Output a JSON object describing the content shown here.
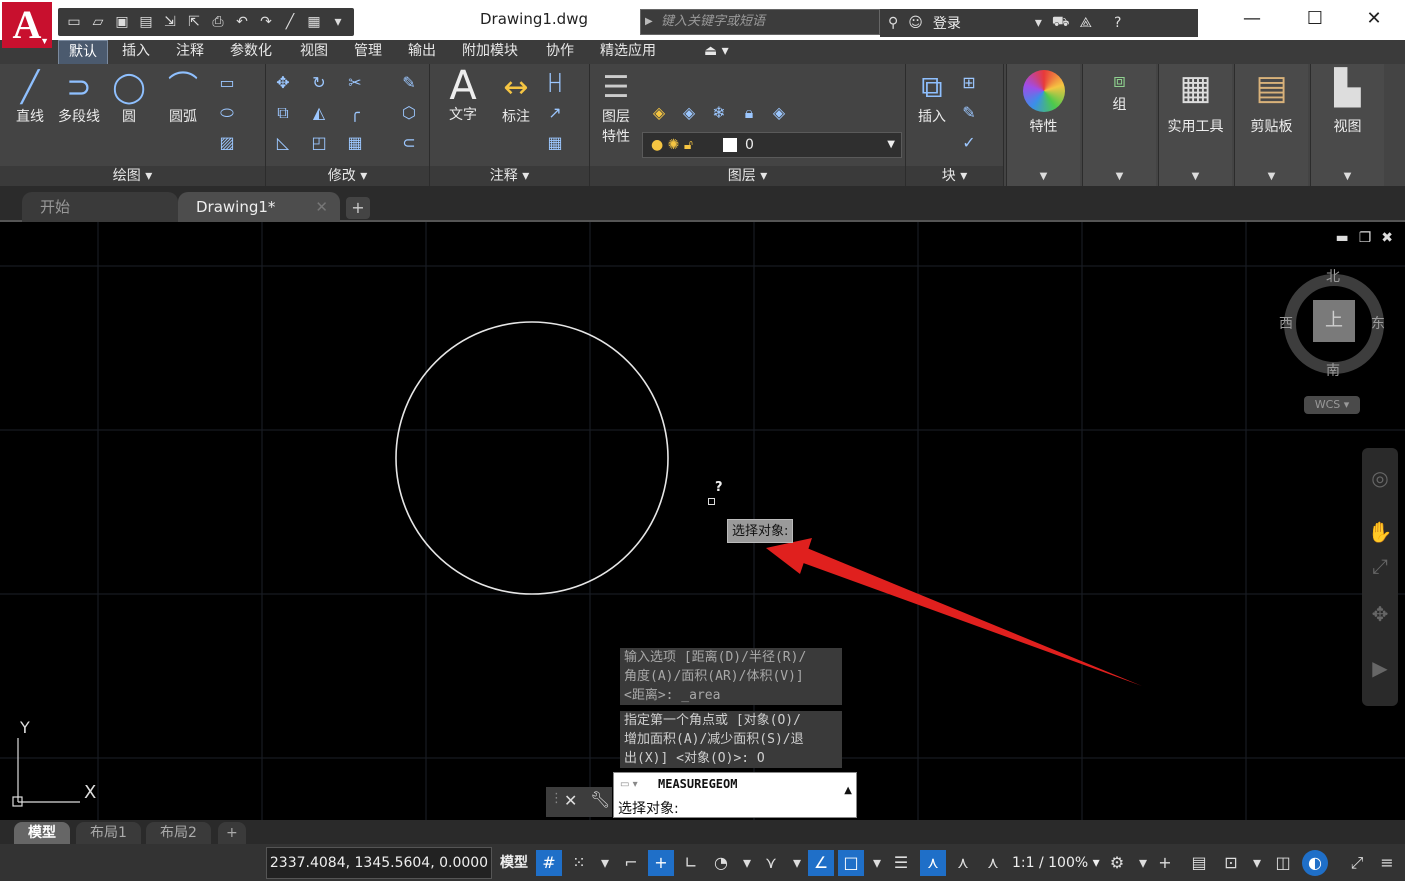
{
  "title_bar": {
    "app_logo": "A",
    "document_title": "Drawing1.dwg",
    "search_placeholder": "键入关键字或短语",
    "login_label": "登录"
  },
  "ribbon_tabs": [
    "默认",
    "插入",
    "注释",
    "参数化",
    "视图",
    "管理",
    "输出",
    "附加模块",
    "协作",
    "精选应用"
  ],
  "ribbon": {
    "draw": {
      "tools": [
        "直线",
        "多段线",
        "圆",
        "圆弧"
      ],
      "footer": "绘图"
    },
    "modify": {
      "footer": "修改"
    },
    "annotation": {
      "tools": [
        "文字",
        "标注"
      ],
      "footer": "注释"
    },
    "layers": {
      "tool_line1": "图层",
      "tool_line2": "特性",
      "current_layer": "0",
      "footer": "图层"
    },
    "block": {
      "tool": "插入",
      "footer": "块"
    },
    "properties": "特性",
    "group": "组",
    "utilities": "实用工具",
    "clipboard": "剪贴板",
    "view": "视图"
  },
  "file_tabs": [
    "开始",
    "Drawing1*"
  ],
  "viewcube": {
    "north": "北",
    "south": "南",
    "east": "东",
    "west": "西",
    "face": "上",
    "wcs": "WCS"
  },
  "cursor": {
    "query_mark": "?",
    "tooltip": "选择对象:"
  },
  "command_history": [
    [
      "输入选项 [距离(D)/半径(R)/",
      "角度(A)/面积(AR)/体积(V)]",
      "<距离>: _area"
    ],
    [
      "指定第一个角点或 [对象(O)/",
      "增加面积(A)/减少面积(S)/退",
      "出(X)] <对象(O)>: O"
    ]
  ],
  "command_line": {
    "command": "MEASUREGEOM",
    "prompt": "选择对象:"
  },
  "ucs": {
    "y": "Y",
    "x": "X"
  },
  "layout_tabs": [
    "模型",
    "布局1",
    "布局2"
  ],
  "status_bar": {
    "coordinates": "2337.4084, 1345.5604, 0.0000",
    "space": "模型",
    "annotation_scale": "1:1 / 100%"
  },
  "colors": {
    "accent_blue": "#1f6fc8",
    "logo_red": "#c8102e",
    "annotation_arrow": "#e0201e"
  }
}
